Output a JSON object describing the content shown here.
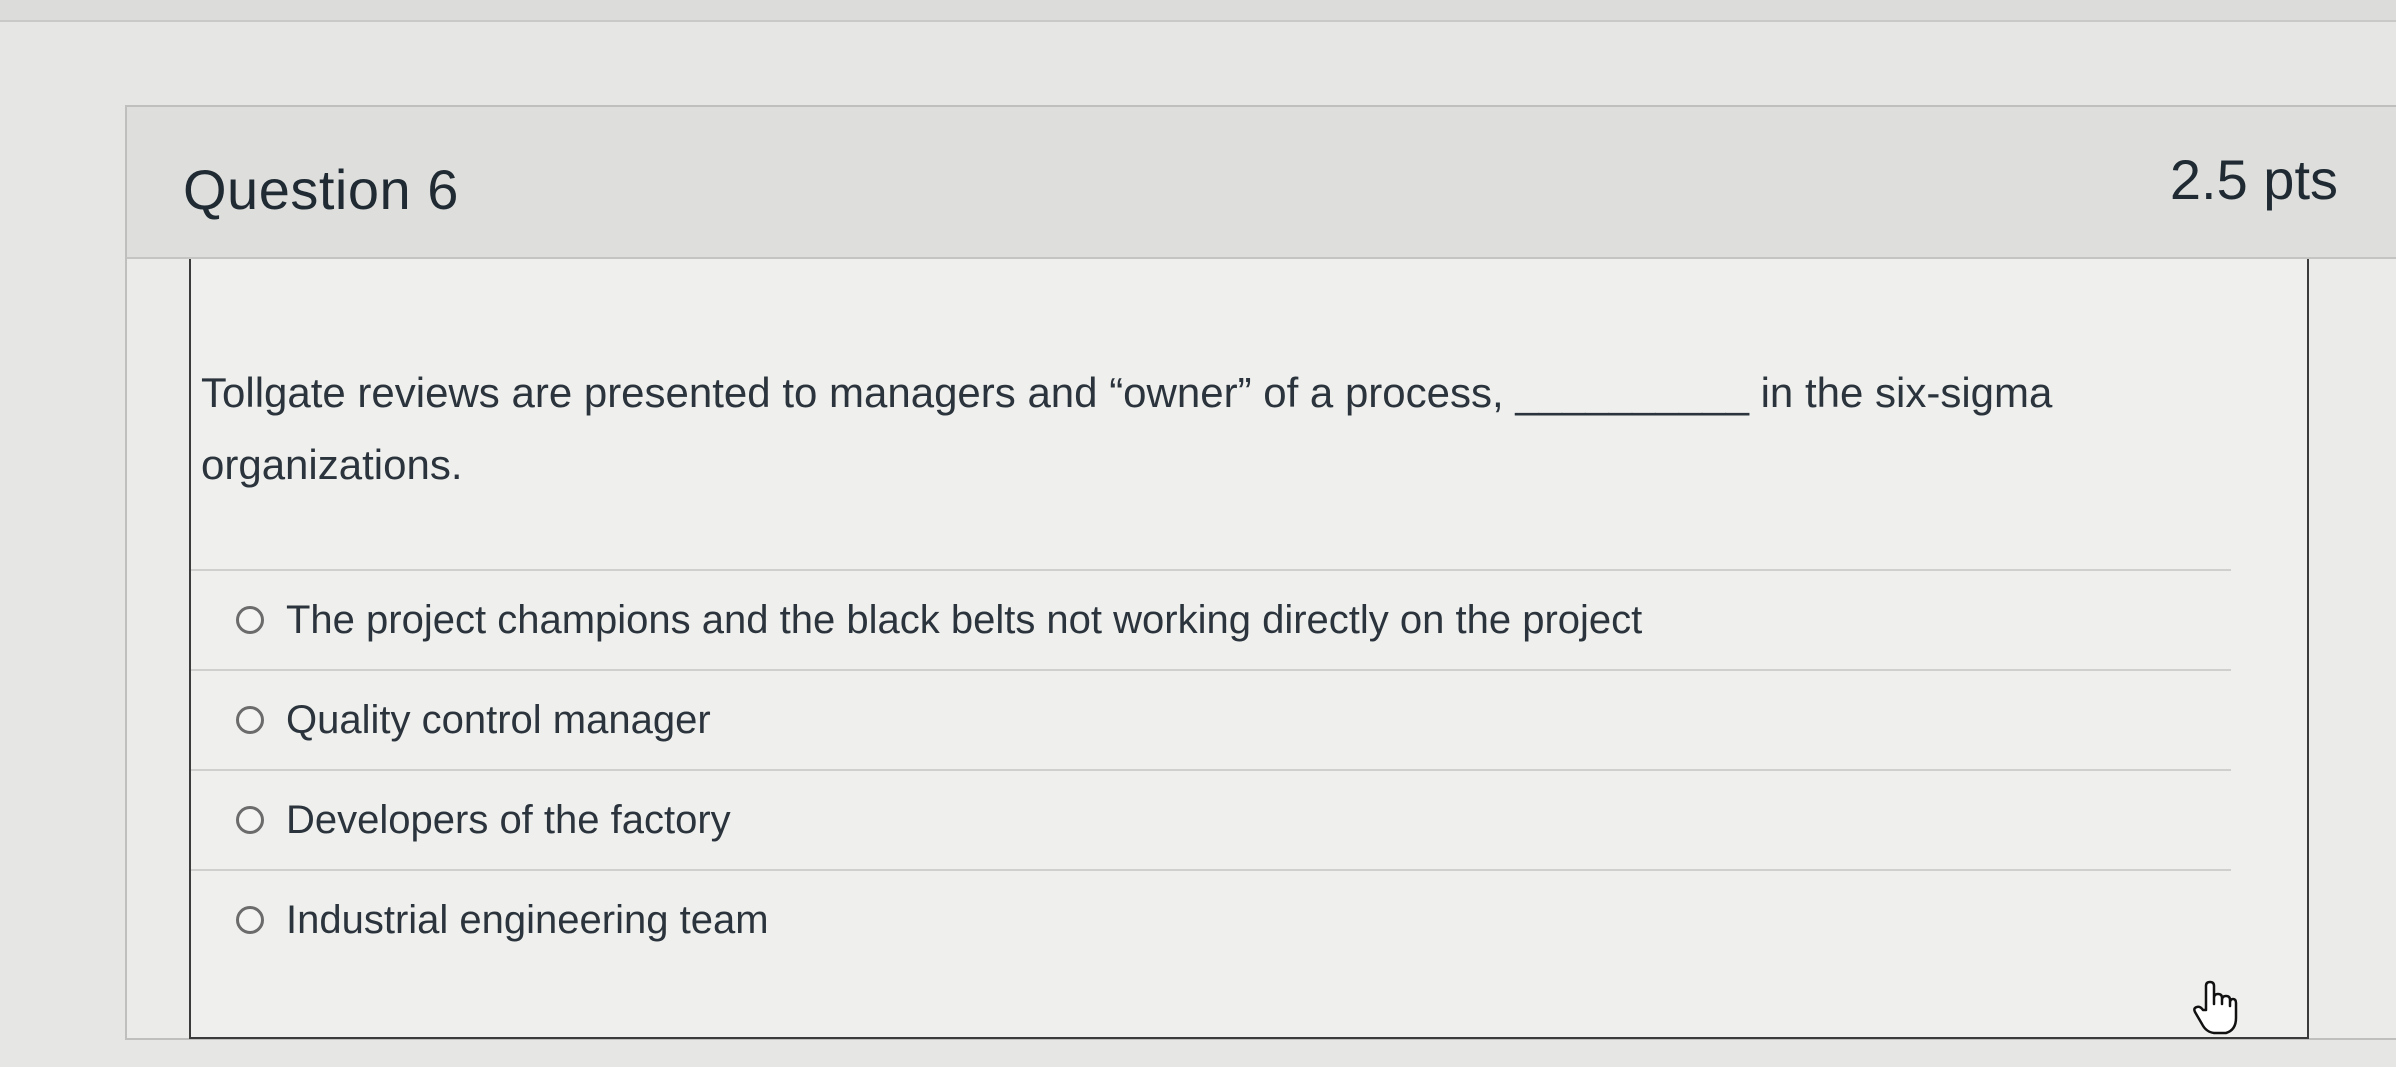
{
  "question": {
    "title": "Question 6",
    "points": "2.5 pts",
    "text": "Tollgate reviews are presented to managers and “owner” of a process, __________ in the six-sigma organizations.",
    "answers": [
      {
        "label": "The project champions and the black belts not working directly on the project",
        "selected": false
      },
      {
        "label": "Quality control manager",
        "selected": false
      },
      {
        "label": "Developers of the factory",
        "selected": false
      },
      {
        "label": "Industrial engineering team",
        "selected": false
      }
    ]
  },
  "cursor": {
    "icon": "hand-pointer-icon"
  }
}
